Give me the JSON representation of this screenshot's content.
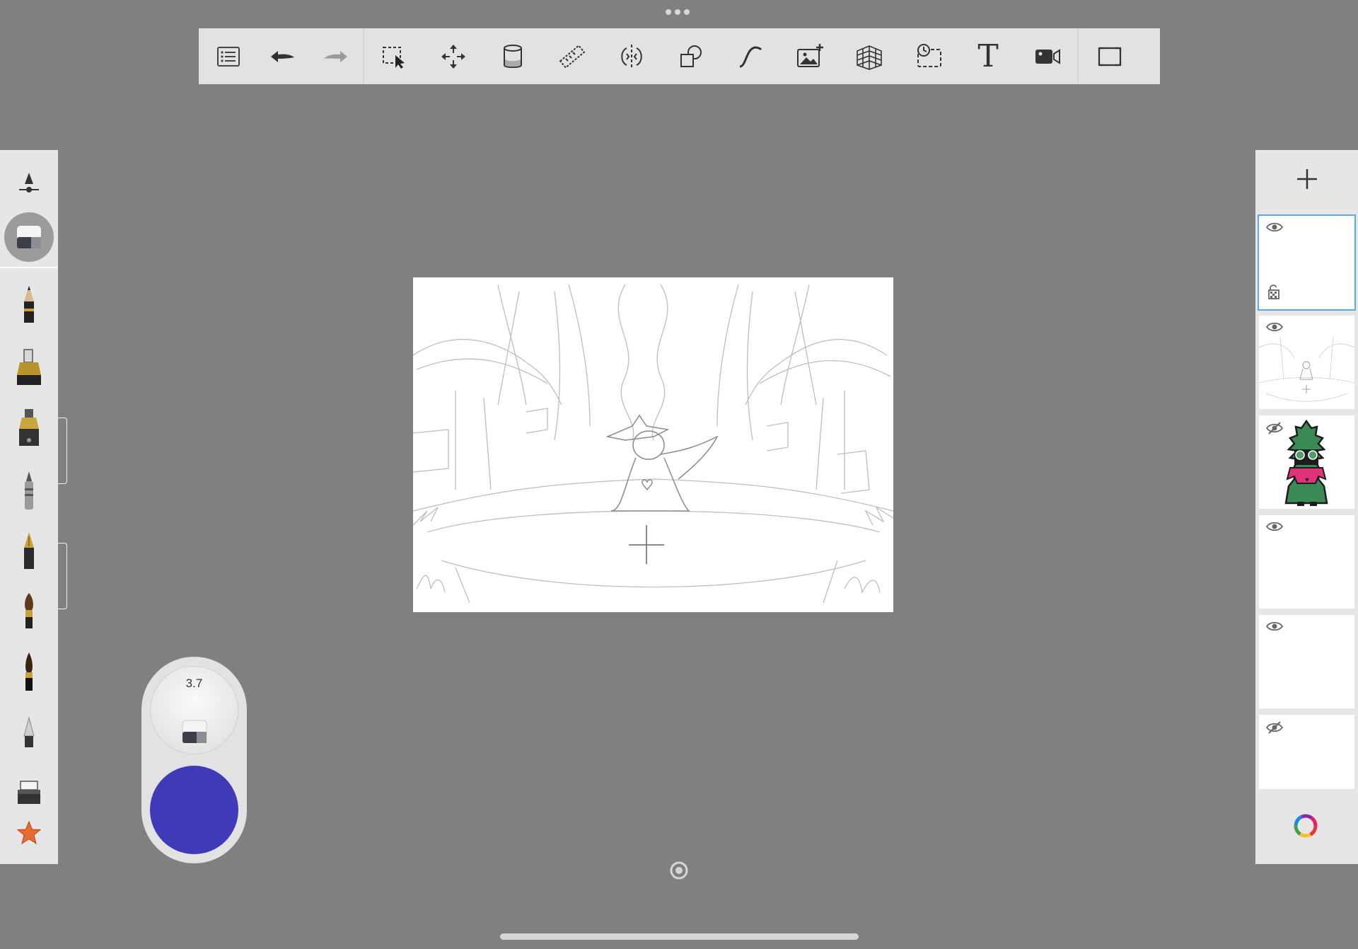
{
  "toolbar": {
    "buttons": [
      {
        "name": "layers-list-icon"
      },
      {
        "name": "undo-icon"
      },
      {
        "name": "redo-icon"
      },
      {
        "name": "selection-icon"
      },
      {
        "name": "transform-move-icon"
      },
      {
        "name": "fill-bucket-icon"
      },
      {
        "name": "ruler-icon"
      },
      {
        "name": "symmetry-icon"
      },
      {
        "name": "shapes-icon"
      },
      {
        "name": "curve-icon"
      },
      {
        "name": "import-image-icon"
      },
      {
        "name": "perspective-grid-icon"
      },
      {
        "name": "time-lapse-icon"
      },
      {
        "name": "text-icon"
      },
      {
        "name": "video-record-icon"
      },
      {
        "name": "fullscreen-icon"
      }
    ],
    "text_label": "T"
  },
  "brush_puck": {
    "size_value": "3.7",
    "current_color": "#3f3ab7"
  },
  "brushes": [
    "opacity-size-slider-icon",
    "eraser-icon",
    "pencil-icon",
    "marker-icon",
    "technical-pen-icon",
    "ballpoint-pen-icon",
    "fountain-pen-icon",
    "paint-brush-icon",
    "ink-brush-icon",
    "airbrush-icon",
    "stamp-brush-icon",
    "favorites-star-icon"
  ],
  "layers": [
    {
      "visible": true,
      "selected": true,
      "locked_transparency": true
    },
    {
      "visible": true,
      "content": "sketch"
    },
    {
      "visible": false,
      "content": "character"
    },
    {
      "visible": true
    },
    {
      "visible": true
    },
    {
      "visible": false
    }
  ],
  "colors": {
    "background": "#808080",
    "panel": "#e6e6e6",
    "selection": "#5ea8ef",
    "accent_color": "#3f3ab7"
  }
}
